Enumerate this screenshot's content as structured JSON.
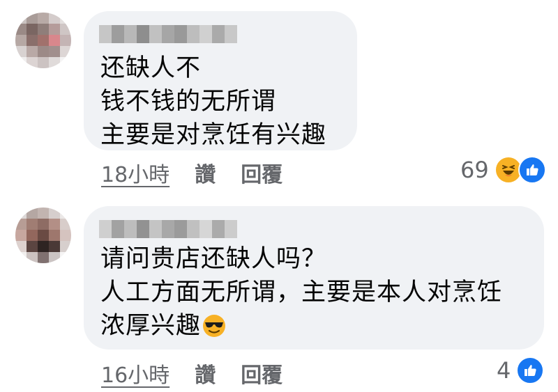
{
  "comments": [
    {
      "lines": [
        "还缺人不",
        "钱不钱的无所谓",
        "主要是对烹饪有兴趣"
      ],
      "time": "18小時",
      "like": "讚",
      "reply": "回覆",
      "reaction_count": "69",
      "reactions": [
        "haha-icon",
        "like-icon"
      ]
    },
    {
      "lines": [
        "请问贵店还缺人吗？",
        "人工方面无所谓，主要是本人对烹饪",
        "浓厚兴趣"
      ],
      "trailing_emoji": "sunglasses-emoji",
      "time": "16小時",
      "like": "讚",
      "reply": "回覆",
      "reaction_count": "4",
      "reactions": [
        "like-icon"
      ]
    }
  ],
  "colors": {
    "bubble": "#f0f2f5",
    "meta_text": "#65676b",
    "like_blue": "#1877f2",
    "haha_yellow": "#f7b125"
  }
}
